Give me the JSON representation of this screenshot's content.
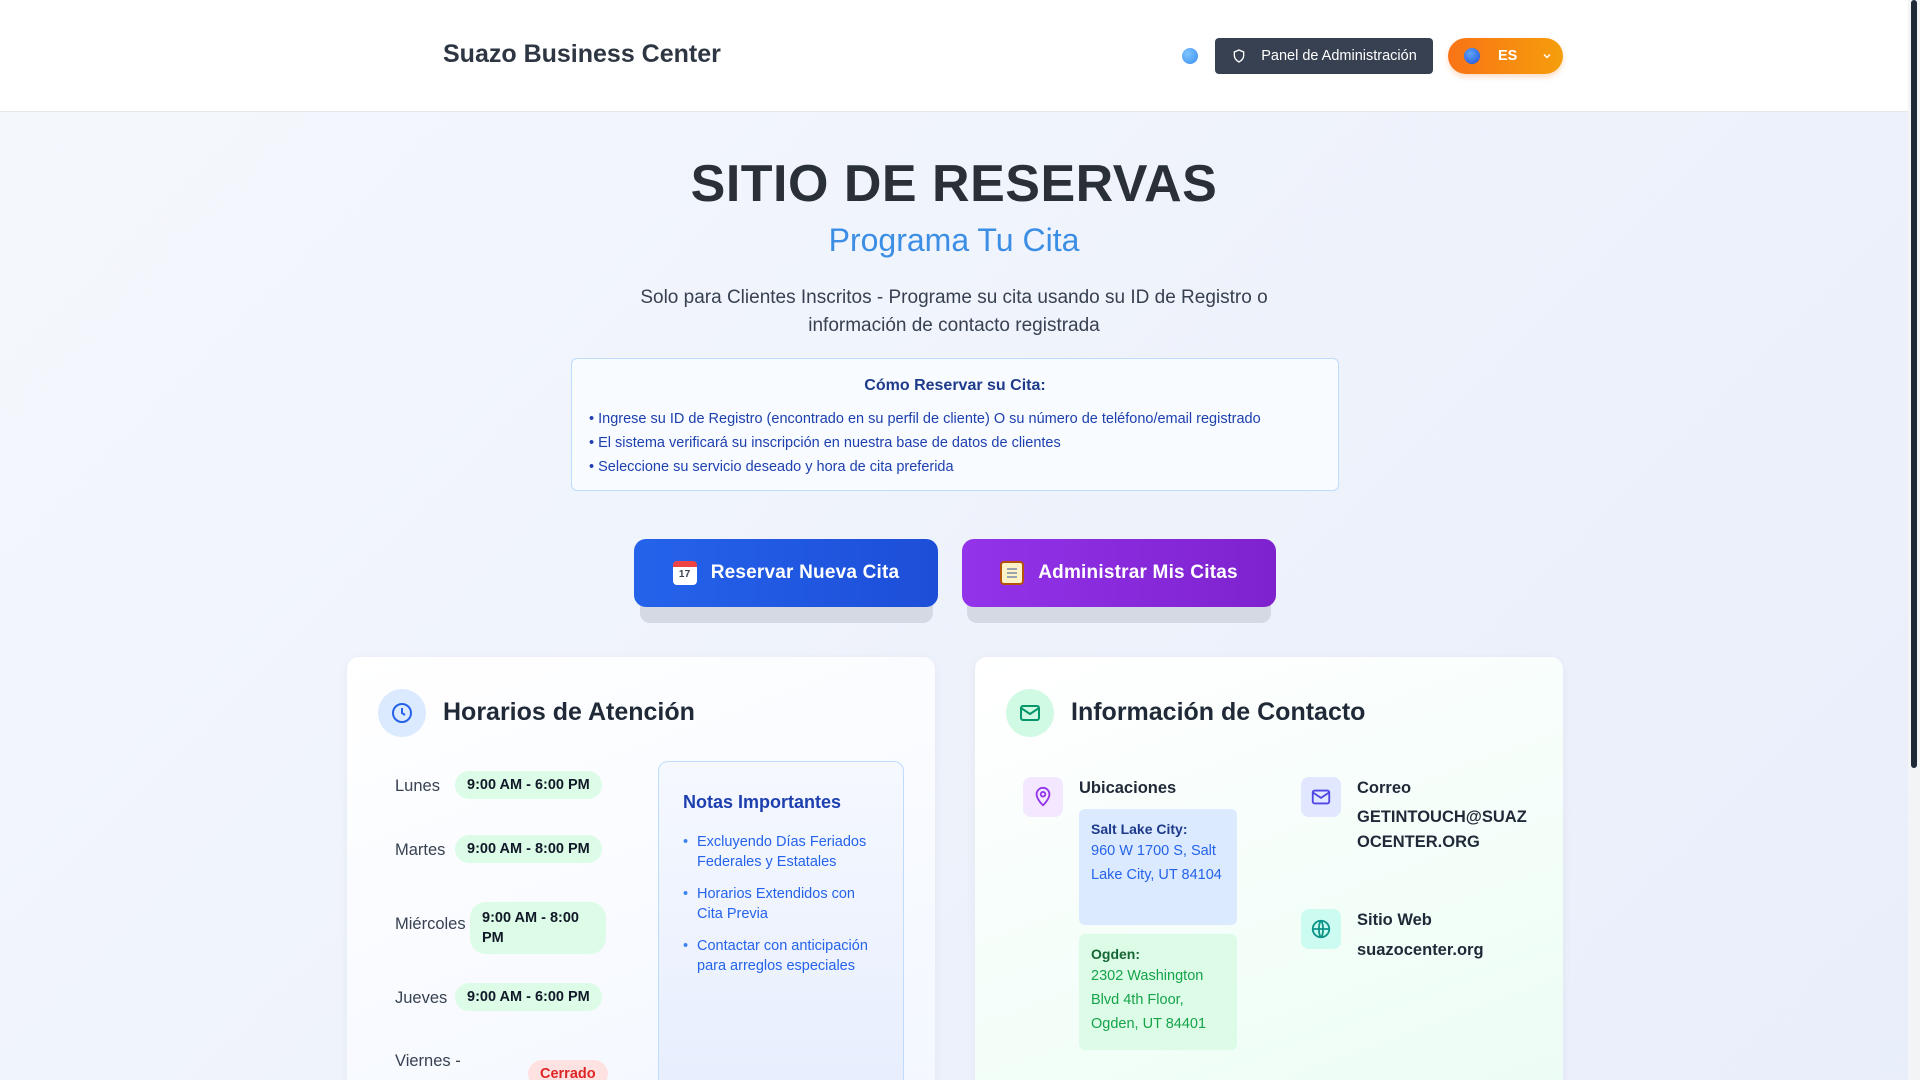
{
  "header": {
    "brand": "Suazo Business Center",
    "admin_label": "Panel de Administración",
    "language": "ES"
  },
  "hero": {
    "title": "SITIO DE RESERVAS",
    "subtitle": "Programa Tu Cita",
    "description": "Solo para Clientes Inscritos - Programe su cita usando su ID de Registro o información de contacto registrada"
  },
  "howto": {
    "title": "Cómo Reservar su Cita:",
    "steps": [
      "Ingrese su ID de Registro (encontrado en su perfil de cliente) O su número de teléfono/email registrado",
      "El sistema verificará su inscripción en nuestra base de datos de clientes",
      "Seleccione su servicio deseado y hora de cita preferida"
    ]
  },
  "actions": {
    "reserve": "Reservar Nueva Cita",
    "manage": "Administrar Mis Citas"
  },
  "hours": {
    "title": "Horarios de Atención",
    "days": [
      {
        "day": "Lunes",
        "time": "9:00 AM - 6:00 PM"
      },
      {
        "day": "Martes",
        "time": "9:00 AM - 8:00 PM"
      },
      {
        "day": "Miércoles",
        "time": "9:00 AM - 8:00 PM"
      },
      {
        "day": "Jueves",
        "time": "9:00 AM - 6:00 PM"
      },
      {
        "day": "Viernes -",
        "time": "Cerrado"
      }
    ],
    "notes_title": "Notas Importantes",
    "notes": [
      "Excluyendo Días Feriados Federales y Estatales",
      "Horarios Extendidos con Cita Previa",
      "Contactar con anticipación para arreglos especiales"
    ]
  },
  "contact": {
    "title": "Información de Contacto",
    "locations_label": "Ubicaciones",
    "locations": [
      {
        "name": "Salt Lake City:",
        "address": "960 W 1700 S, Salt Lake City, UT 84104"
      },
      {
        "name": "Ogden:",
        "address": "2302 Washington Blvd 4th Floor, Ogden, UT 84401"
      }
    ],
    "email_label": "Correo",
    "email": "GETINTOUCH@SUAZOCENTER.ORG",
    "website_label": "Sitio Web",
    "website": "suazocenter.org"
  },
  "colors": {
    "primary_blue": "#2563eb",
    "purple": "#9333ea",
    "orange": "#f97316",
    "dark_header_button": "#374151"
  },
  "icons": [
    "theme-toggle-icon",
    "shield-icon",
    "globe-icon",
    "chevron-down-icon",
    "calendar-icon",
    "clipboard-icon",
    "clock-icon",
    "mail-icon",
    "map-pin-icon",
    "globe-icon"
  ]
}
